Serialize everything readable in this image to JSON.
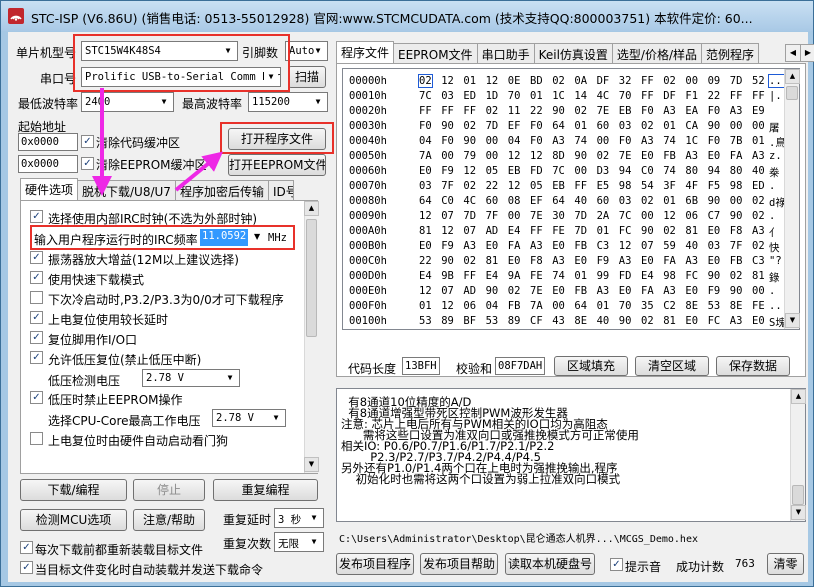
{
  "window": {
    "title": "STC-ISP (V6.86U) (销售电话: 0513-55012928) 官网:www.STCMCUDATA.com (技术支持QQ:800003751) 本软件定价: 60..."
  },
  "left": {
    "mcu_label": "单片机型号",
    "mcu_value": "STC15W4K48S4",
    "pin_label": "引脚数",
    "pin_value": "Auto",
    "port_label": "串口号",
    "port_value": "Prolific USB-to-Serial Comm Port",
    "scan_button": "扫描",
    "min_baud_label": "最低波特率",
    "min_baud_value": "2400",
    "max_baud_label": "最高波特率",
    "max_baud_value": "115200",
    "start_addr_label": "起始地址",
    "addr1": "0x0000",
    "clear_code_label": "清除代码缓冲区",
    "open_prog_button": "打开程序文件",
    "addr2": "0x0000",
    "clear_eeprom_label": "清除EEPROM缓冲区",
    "open_eeprom_button": "打开EEPROM文件",
    "tabs": [
      "硬件选项",
      "脱机下载/U8/U7",
      "程序加密后传输",
      "ID号"
    ],
    "options": {
      "irc": "选择使用内部IRC时钟(不选为外部时钟)",
      "freq_label": "输入用户程序运行时的IRC频率",
      "freq_value": "11.0592",
      "freq_unit": "MHz",
      "osc_gain": "振荡器放大增益(12M以上建议选择)",
      "fast_dl": "使用快速下载模式",
      "p32p33": "下次冷启动时,P3.2/P3.3为0/0才可下载程序",
      "long_delay": "上电复位使用较长延时",
      "reset_io": "复位脚用作I/O口",
      "lv_reset": "允许低压复位(禁止低压中断)",
      "lv_detect_label": "低压检测电压",
      "lv_detect_value": "2.78 V",
      "lv_eeprom": "低压时禁止EEPROM操作",
      "cpu_volt_label": "选择CPU-Core最高工作电压",
      "cpu_volt_value": "2.78 V",
      "watchdog": "上电复位时由硬件自动启动看门狗"
    },
    "btn_download": "下载/编程",
    "btn_stop": "停止",
    "btn_reprogram": "重复编程",
    "btn_detect": "检测MCU选项",
    "btn_help": "注意/帮助",
    "repeat_delay_label": "重复延时",
    "repeat_delay_value": "3 秒",
    "repeat_count_label": "重复次数",
    "repeat_count_value": "无限",
    "reload_label": "每次下载前都重新装载目标文件",
    "auto_load_label": "当目标文件变化时自动装载并发送下载命令"
  },
  "right": {
    "tabs": [
      "程序文件",
      "EEPROM文件",
      "串口助手",
      "Keil仿真设置",
      "选型/价格/样品",
      "范例程序"
    ],
    "hex_rows": [
      {
        "addr": "00000h",
        "bytes": [
          "02",
          "12",
          "01",
          "12",
          "0E",
          "BD",
          "02",
          "0A",
          "DF",
          "32",
          "FF",
          "02",
          "00",
          "09",
          "7D",
          "52"
        ],
        "ascii": "..."
      },
      {
        "addr": "00010h",
        "bytes": [
          "7C",
          "03",
          "ED",
          "1D",
          "70",
          "01",
          "1C",
          "14",
          "4C",
          "70",
          "FF",
          "DF",
          "F1",
          "22",
          "FF",
          "FF"
        ],
        "ascii": "|."
      },
      {
        "addr": "00020h",
        "bytes": [
          "FF",
          "FF",
          "FF",
          "02",
          "11",
          "22",
          "90",
          "02",
          "7E",
          "EB",
          "F0",
          "A3",
          "EA",
          "F0",
          "A3",
          "E9"
        ],
        "ascii": ""
      },
      {
        "addr": "00030h",
        "bytes": [
          "F0",
          "90",
          "02",
          "7D",
          "EF",
          "F0",
          "64",
          "01",
          "60",
          "03",
          "02",
          "01",
          "CA",
          "90",
          "00",
          "00"
        ],
        "ascii": "屠"
      },
      {
        "addr": "00040h",
        "bytes": [
          "04",
          "F0",
          "90",
          "00",
          "04",
          "F0",
          "A3",
          "74",
          "00",
          "F0",
          "A3",
          "74",
          "1C",
          "F0",
          "7B",
          "01"
        ],
        "ascii": ".鳥"
      },
      {
        "addr": "00050h",
        "bytes": [
          "7A",
          "00",
          "79",
          "00",
          "12",
          "12",
          "8D",
          "90",
          "02",
          "7E",
          "E0",
          "FB",
          "A3",
          "E0",
          "FA",
          "A3"
        ],
        "ascii": "z."
      },
      {
        "addr": "00060h",
        "bytes": [
          "E0",
          "F9",
          "12",
          "05",
          "EB",
          "FD",
          "7C",
          "00",
          "D3",
          "94",
          "C0",
          "74",
          "80",
          "94",
          "80",
          "40"
        ],
        "ascii": "桊"
      },
      {
        "addr": "00070h",
        "bytes": [
          "03",
          "7F",
          "02",
          "22",
          "12",
          "05",
          "EB",
          "FF",
          "E5",
          "98",
          "54",
          "3F",
          "4F",
          "F5",
          "98",
          "ED"
        ],
        "ascii": "."
      },
      {
        "addr": "00080h",
        "bytes": [
          "64",
          "C0",
          "4C",
          "60",
          "08",
          "EF",
          "64",
          "40",
          "60",
          "03",
          "02",
          "01",
          "6B",
          "90",
          "00",
          "02"
        ],
        "ascii": "d祿"
      },
      {
        "addr": "00090h",
        "bytes": [
          "12",
          "07",
          "7D",
          "7F",
          "00",
          "7E",
          "30",
          "7D",
          "2A",
          "7C",
          "00",
          "12",
          "06",
          "C7",
          "90",
          "02"
        ],
        "ascii": "."
      },
      {
        "addr": "000A0h",
        "bytes": [
          "81",
          "12",
          "07",
          "AD",
          "E4",
          "FF",
          "FE",
          "7D",
          "01",
          "FC",
          "90",
          "02",
          "81",
          "E0",
          "F8",
          "A3"
        ],
        "ascii": "亻"
      },
      {
        "addr": "000B0h",
        "bytes": [
          "E0",
          "F9",
          "A3",
          "E0",
          "FA",
          "A3",
          "E0",
          "FB",
          "C3",
          "12",
          "07",
          "59",
          "40",
          "03",
          "7F",
          "02"
        ],
        "ascii": "快"
      },
      {
        "addr": "000C0h",
        "bytes": [
          "22",
          "90",
          "02",
          "81",
          "E0",
          "F8",
          "A3",
          "E0",
          "F9",
          "A3",
          "E0",
          "FA",
          "A3",
          "E0",
          "FB",
          "C3"
        ],
        "ascii": "\"?"
      },
      {
        "addr": "000D0h",
        "bytes": [
          "E4",
          "9B",
          "FF",
          "E4",
          "9A",
          "FE",
          "74",
          "01",
          "99",
          "FD",
          "E4",
          "98",
          "FC",
          "90",
          "02",
          "81"
        ],
        "ascii": "錄"
      },
      {
        "addr": "000E0h",
        "bytes": [
          "12",
          "07",
          "AD",
          "90",
          "02",
          "7E",
          "E0",
          "FB",
          "A3",
          "E0",
          "FA",
          "A3",
          "E0",
          "F9",
          "90",
          "00"
        ],
        "ascii": "."
      },
      {
        "addr": "000F0h",
        "bytes": [
          "01",
          "12",
          "06",
          "04",
          "FB",
          "7A",
          "00",
          "64",
          "01",
          "70",
          "35",
          "C2",
          "8E",
          "53",
          "8E",
          "FE"
        ],
        "ascii": ".."
      },
      {
        "addr": "00100h",
        "bytes": [
          "53",
          "89",
          "BF",
          "53",
          "89",
          "CF",
          "43",
          "8E",
          "40",
          "90",
          "02",
          "81",
          "E0",
          "FC",
          "A3",
          "E0"
        ],
        "ascii": "S塊"
      }
    ],
    "code_len_label": "代码长度",
    "code_len_value": "13BFH",
    "checksum_label": "校验和",
    "checksum_value": "08F7DAH",
    "btn_fill": "区域填充",
    "btn_clear": "清空区域",
    "btn_save": "保存数据",
    "log_lines": [
      "  有8通道10位精度的A/D",
      "  有8通道增强型带死区控制PWM波形发生器",
      "",
      "注意: 芯片上电后所有与PWM相关的IO口均为高阻态",
      "      需将这些口设置为准双向口或强推挽模式方可正常使用",
      "相关IO: P0.6/P0.7/P1.6/P1.7/P2.1/P2.2",
      "        P2.3/P2.7/P3.7/P4.2/P4.4/P4.5",
      "另外还有P1.0/P1.4两个口在上电时为强推挽输出,程序",
      "    初始化时也需将这两个口设置为弱上拉准双向口模式"
    ],
    "file_path": "C:\\Users\\Administrator\\Desktop\\昆仑通态人机界...\\MCGS_Demo.hex",
    "btn_publish": "发布项目程序",
    "btn_publish_help": "发布项目帮助",
    "btn_read_hdd": "读取本机硬盘号",
    "sound_label": "提示音",
    "success_label": "成功计数",
    "success_value": "763",
    "btn_clear_count": "清零"
  },
  "colors": {
    "highlight": "#e8312a",
    "arrow": "#ee28e6",
    "selection": "#3399ff"
  }
}
